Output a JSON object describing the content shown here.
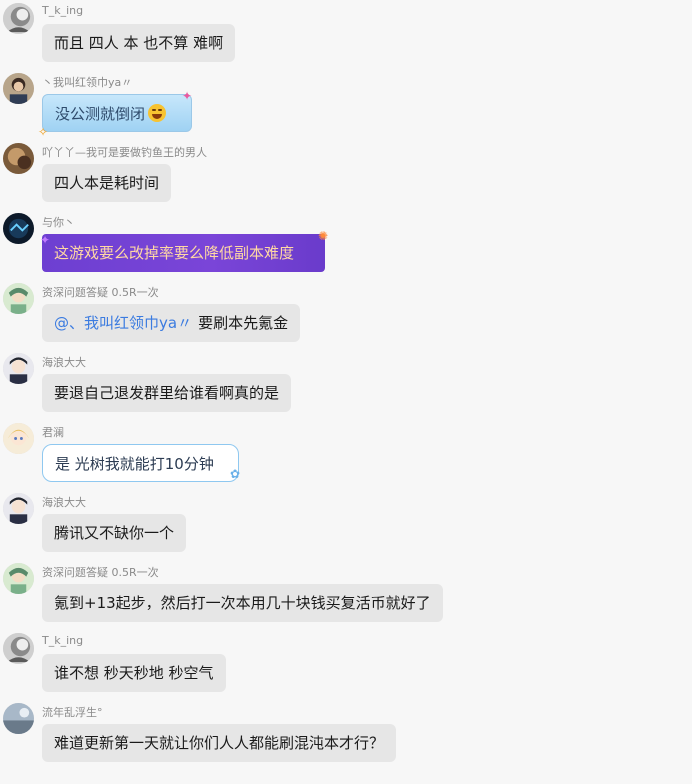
{
  "messages": [
    {
      "sender": "T_k_ing",
      "text": "而且 四人 本 也不算 难啊"
    },
    {
      "sender": "丶我叫红领巾ya〃",
      "text": "没公测就倒闭"
    },
    {
      "sender": "吖丫丫—我可是要做钓鱼王的男人",
      "text": "四人本是耗时间"
    },
    {
      "sender": "与你丶",
      "text": "这游戏要么改掉率要么降低副本难度"
    },
    {
      "sender": "资深问题答疑 0.5R一次",
      "mention": "@、我叫红领巾ya〃",
      "text": "要刷本先氪金"
    },
    {
      "sender": "海浪大大",
      "text": "要退自己退发群里给谁看啊真的是"
    },
    {
      "sender": "君澜",
      "text": "是 光树我就能打10分钟"
    },
    {
      "sender": "海浪大大",
      "text": "腾讯又不缺你一个"
    },
    {
      "sender": "资深问题答疑 0.5R一次",
      "text": "氪到+13起步，然后打一次本用几十块钱买复活币就好了"
    },
    {
      "sender": "T_k_ing",
      "text": "谁不想 秒天秒地 秒空气"
    },
    {
      "sender": "流年乱浮生°",
      "text": "难道更新第一天就让你们人人都能刷混沌本才行？"
    }
  ],
  "emoji": {
    "laugh": "laughing-emoji"
  }
}
